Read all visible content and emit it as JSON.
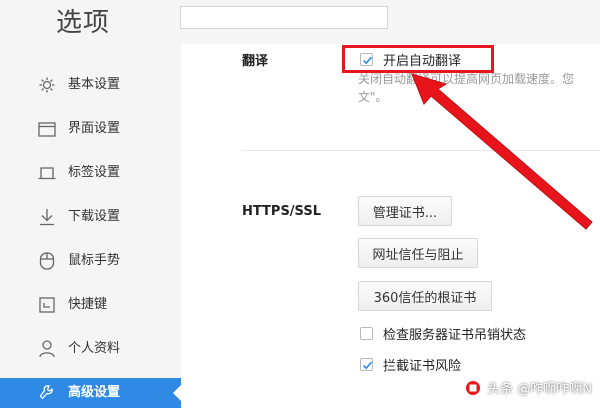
{
  "header": {
    "title": "选项",
    "search_value": ""
  },
  "sidebar": {
    "items": [
      {
        "label": "基本设置",
        "icon": "gear-icon"
      },
      {
        "label": "界面设置",
        "icon": "window-icon"
      },
      {
        "label": "标签设置",
        "icon": "tab-icon"
      },
      {
        "label": "下载设置",
        "icon": "download-icon"
      },
      {
        "label": "鼠标手势",
        "icon": "mouse-icon"
      },
      {
        "label": "快捷键",
        "icon": "keyboard-icon"
      },
      {
        "label": "个人资料",
        "icon": "person-icon"
      },
      {
        "label": "高级设置",
        "icon": "wrench-icon"
      }
    ],
    "active_index": 7
  },
  "translate": {
    "section_label": "翻译",
    "checkbox_label": "开启自动翻译",
    "checked": true,
    "description_line1": "关闭自动翻译可以提高网页加载速度。您",
    "description_line2": "文\"。"
  },
  "https": {
    "section_label": "HTTPS/SSL",
    "manage_cert_button": "管理证书...",
    "url_trust_button": "网址信任与阻止",
    "root_cert_button": "360信任的根证书",
    "check_revocation_label": "检查服务器证书吊销状态",
    "check_revocation_checked": false,
    "block_risk_label": "拦截证书风险",
    "block_risk_checked": true
  },
  "watermark": {
    "text": "头条 @咋啊咋啊N"
  },
  "colors": {
    "accent": "#2f8ae5",
    "highlight": "#e5161d",
    "sidebar_bg": "#f5f5f5"
  }
}
